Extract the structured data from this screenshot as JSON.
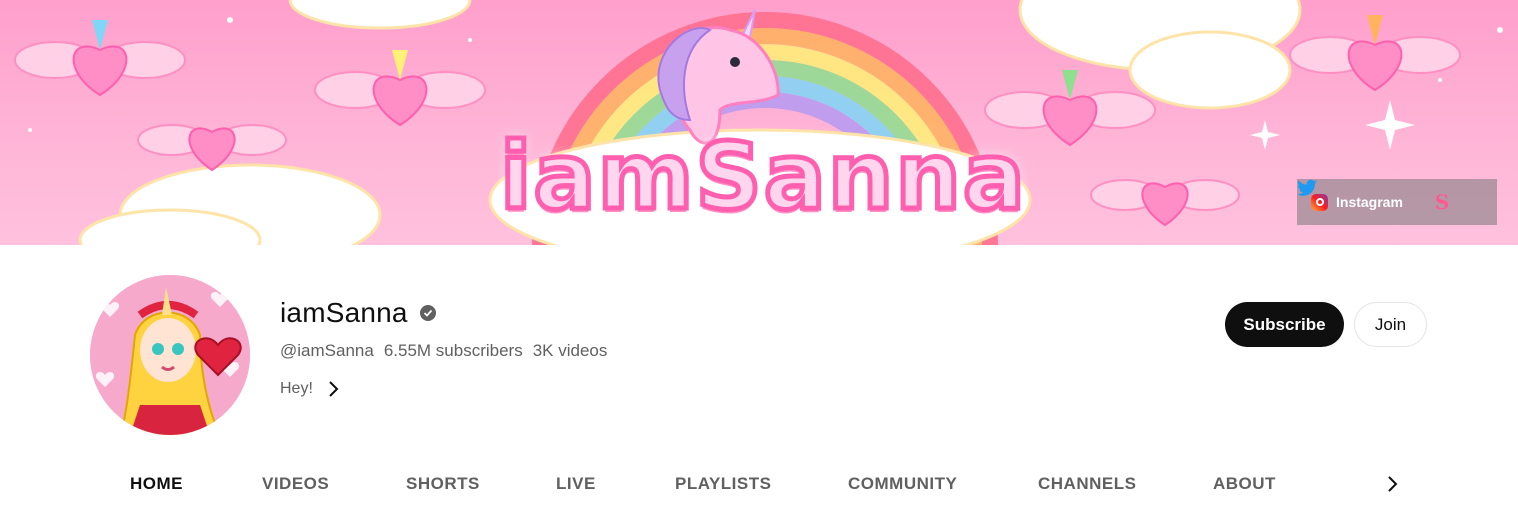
{
  "banner": {
    "title_art": "iamSanna",
    "links": {
      "instagram_label": "Instagram",
      "icons": [
        "instagram-icon",
        "twitter-icon",
        "sanna-s-icon"
      ],
      "s_glyph": "S"
    }
  },
  "channel": {
    "name": "iamSanna",
    "handle": "@iamSanna",
    "subscribers": "6.55M subscribers",
    "videos": "3K videos",
    "description": "Hey!",
    "verified": true
  },
  "actions": {
    "subscribe_label": "Subscribe",
    "join_label": "Join"
  },
  "tabs": [
    {
      "label": "HOME",
      "active": true
    },
    {
      "label": "VIDEOS",
      "active": false
    },
    {
      "label": "SHORTS",
      "active": false
    },
    {
      "label": "LIVE",
      "active": false
    },
    {
      "label": "PLAYLISTS",
      "active": false
    },
    {
      "label": "COMMUNITY",
      "active": false
    },
    {
      "label": "CHANNELS",
      "active": false
    },
    {
      "label": "ABOUT",
      "active": false
    }
  ],
  "colors": {
    "banner_pink": "#ff9fcc",
    "subscribe_bg": "#0f0f0f",
    "text_secondary": "#606060"
  }
}
